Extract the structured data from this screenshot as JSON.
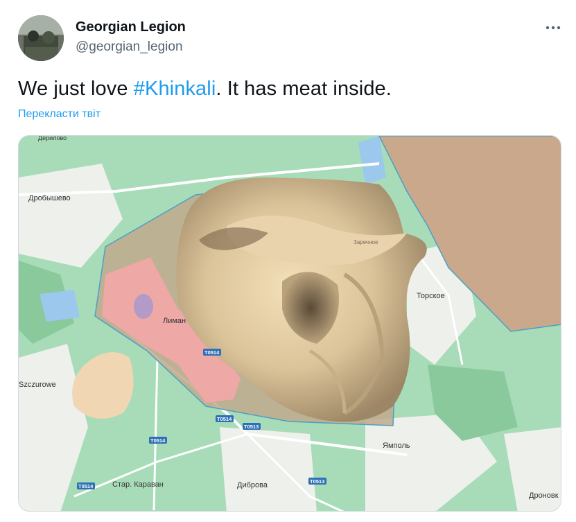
{
  "author": {
    "display_name": "Georgian Legion",
    "handle": "@georgian_legion",
    "avatar_icon": "profile-photo-icon"
  },
  "more_icon": "more-horizontal-icon",
  "tweet": {
    "text_before": "We just love ",
    "hashtag": "#Khinkali",
    "text_after": ". It has meat inside.",
    "translate_label": "Перекласти твіт"
  },
  "colors": {
    "link": "#1d9bf0",
    "text": "#0f1419",
    "secondary": "#536471"
  },
  "map": {
    "labels": {
      "drobysheve": "Дробышево",
      "lyman": "Лиман",
      "torske": "Торское",
      "szczurowe": "Szczurowe",
      "yampol": "Ямполь",
      "stary_karavan": "Стар. Караван",
      "dibrova": "Диброва",
      "dronovka": "Дроновк",
      "zarechnoe": "Заречное",
      "derylovo": "Дерилово"
    },
    "road_labels": {
      "r1": "T0514",
      "r2": "T0514",
      "r3": "T0513",
      "r4": "T0514",
      "r5": "T0514",
      "r6": "T0513"
    }
  }
}
